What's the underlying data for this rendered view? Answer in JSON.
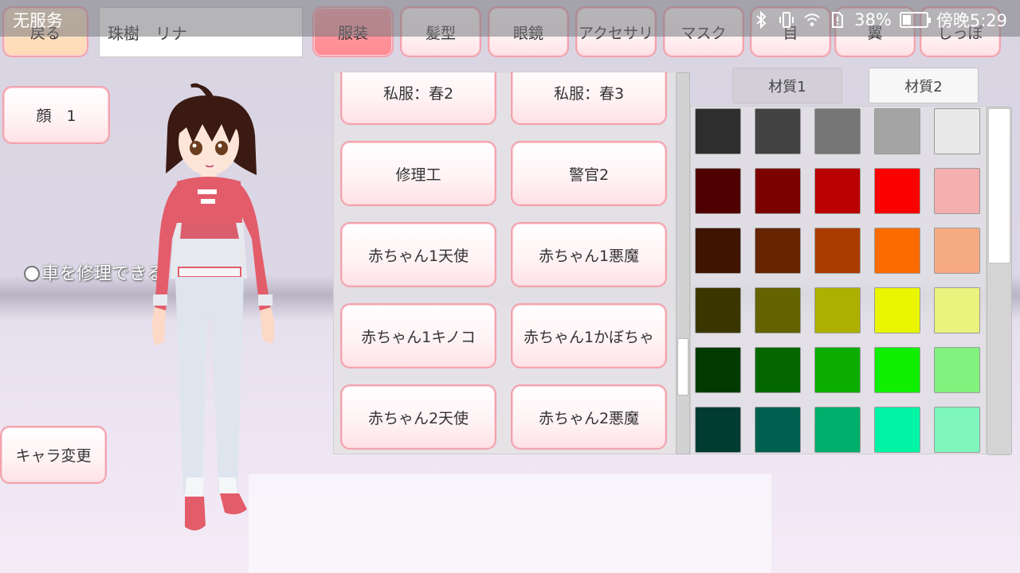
{
  "status_bar": {
    "carrier": "无服务",
    "battery": "38%",
    "battery_level": 0.38,
    "time": "傍晚5:29"
  },
  "top_bar": {
    "back_label": "戻る",
    "name_value": "珠樹　リナ",
    "tabs": [
      {
        "label": "服装",
        "active": true
      },
      {
        "label": "髪型",
        "active": false
      },
      {
        "label": "眼鏡",
        "active": false
      },
      {
        "label": "アクセサリ",
        "active": false
      },
      {
        "label": "マスク",
        "active": false
      },
      {
        "label": "目",
        "active": false
      },
      {
        "label": "翼",
        "active": false
      },
      {
        "label": "しっぽ",
        "active": false
      }
    ]
  },
  "left": {
    "face_label": "顔　1",
    "description": "車を修理できる",
    "change_char_label": "キャラ変更"
  },
  "outfits": [
    "私服：春2",
    "私服：春3",
    "修理工",
    "警官2",
    "赤ちゃん1天使",
    "赤ちゃん1悪魔",
    "赤ちゃん1キノコ",
    "赤ちゃん1かぼちゃ",
    "赤ちゃん2天使",
    "赤ちゃん2悪魔"
  ],
  "outfit_scroll": {
    "position": 0.82,
    "visible_fraction": 0.15
  },
  "material_tabs": [
    {
      "label": "材質1",
      "active": false
    },
    {
      "label": "材質2",
      "active": true
    }
  ],
  "palette": [
    [
      "#2e2e2e",
      "#434343",
      "#767676",
      "#a4a4a4",
      "#e8e8e8"
    ],
    [
      "#4f0000",
      "#7d0000",
      "#ba0000",
      "#fb0000",
      "#f6afaf"
    ],
    [
      "#3f1400",
      "#662400",
      "#ab3c00",
      "#fb6c00",
      "#f6aa82"
    ],
    [
      "#3b3600",
      "#636300",
      "#aeb000",
      "#e9f600",
      "#ebf27e"
    ],
    [
      "#033a00",
      "#046700",
      "#0bad00",
      "#10ef00",
      "#81f27d"
    ],
    [
      "#013c32",
      "#00604f",
      "#00af6b",
      "#00f4a4",
      "#7ef6be"
    ]
  ],
  "colors": {
    "accent_pink": "#ff8b93",
    "button_border": "#f2a3ad"
  }
}
